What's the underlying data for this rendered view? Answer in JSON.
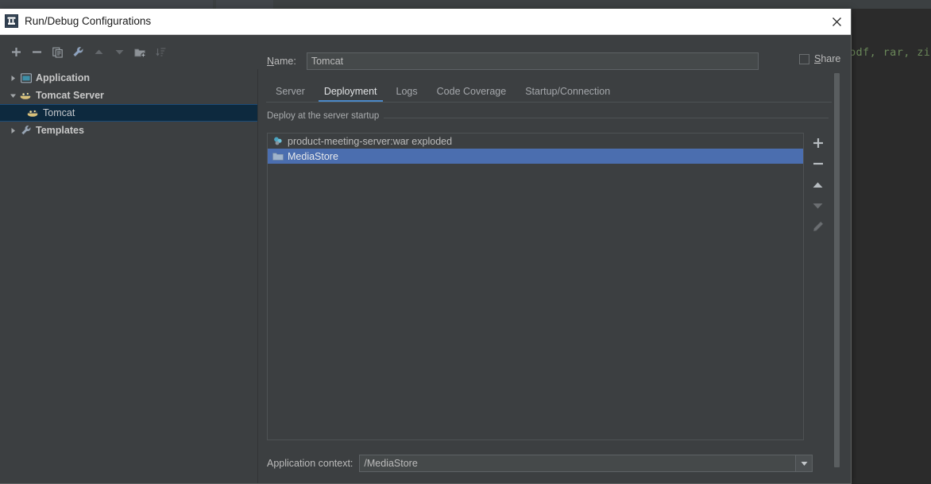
{
  "background": {
    "editor_code": "pdf, rar, zi",
    "editor_code_color": "#6a8759",
    "ide_bg_color": "#313335"
  },
  "dialog": {
    "title": "Run/Debug Configurations",
    "title_icon": "intellij-idea-logo-icon",
    "close_icon": "close-icon",
    "titlebar_bg": "#ffffff"
  },
  "toolbar": {
    "buttons": [
      {
        "name": "add-configuration-button",
        "icon": "plus-icon",
        "enabled": true
      },
      {
        "name": "remove-configuration-button",
        "icon": "minus-icon",
        "enabled": true
      },
      {
        "name": "copy-configuration-button",
        "icon": "copy-icon",
        "enabled": true
      },
      {
        "name": "edit-templates-button",
        "icon": "wrench-icon",
        "enabled": true
      },
      {
        "name": "move-up-button",
        "icon": "arrow-up-icon",
        "enabled": false
      },
      {
        "name": "move-down-button",
        "icon": "arrow-down-icon",
        "enabled": false
      },
      {
        "name": "create-folder-button",
        "icon": "folder-add-icon",
        "enabled": true
      },
      {
        "name": "sort-configurations-button",
        "icon": "sort-icon",
        "enabled": false
      }
    ]
  },
  "tree": {
    "items": [
      {
        "label": "Application",
        "icon": "application-icon",
        "arrow": "collapsed",
        "indent": 0,
        "selected": false,
        "bold": true
      },
      {
        "label": "Tomcat Server",
        "icon": "tomcat-icon",
        "arrow": "expanded",
        "indent": 0,
        "selected": false,
        "bold": true
      },
      {
        "label": "Tomcat",
        "icon": "tomcat-icon",
        "arrow": "none",
        "indent": 1,
        "selected": true,
        "bold": false
      },
      {
        "label": "Templates",
        "icon": "wrench-icon",
        "arrow": "collapsed",
        "indent": 0,
        "selected": false,
        "bold": true
      }
    ]
  },
  "config": {
    "name_label": "Name:",
    "name_mnemonic": "N",
    "name_value": "Tomcat",
    "share_label": "Share",
    "share_mnemonic": "S",
    "share_checked": false
  },
  "tabs": {
    "items": [
      {
        "label": "Server",
        "active": false
      },
      {
        "label": "Deployment",
        "active": true
      },
      {
        "label": "Logs",
        "active": false
      },
      {
        "label": "Code Coverage",
        "active": false
      },
      {
        "label": "Startup/Connection",
        "active": false
      }
    ],
    "active_underline_color": "#4a88c7"
  },
  "deployment": {
    "group_title": "Deploy at the server startup",
    "artifacts": [
      {
        "label": "product-meeting-server:war exploded",
        "icon": "artifact-icon",
        "selected": false
      },
      {
        "label": "MediaStore",
        "icon": "folder-icon",
        "selected": true
      }
    ],
    "selection_color": "#4b6eaf",
    "tools": [
      {
        "name": "add-artifact-button",
        "icon": "plus-icon",
        "enabled": true
      },
      {
        "name": "remove-artifact-button",
        "icon": "minus-icon",
        "enabled": true
      },
      {
        "name": "move-artifact-up-button",
        "icon": "arrow-up-icon",
        "enabled": true
      },
      {
        "name": "move-artifact-down-button",
        "icon": "arrow-down-icon",
        "enabled": false
      },
      {
        "name": "edit-artifact-button",
        "icon": "pencil-icon",
        "enabled": false
      }
    ],
    "context_label": "Application context:",
    "context_value": "/MediaStore"
  }
}
